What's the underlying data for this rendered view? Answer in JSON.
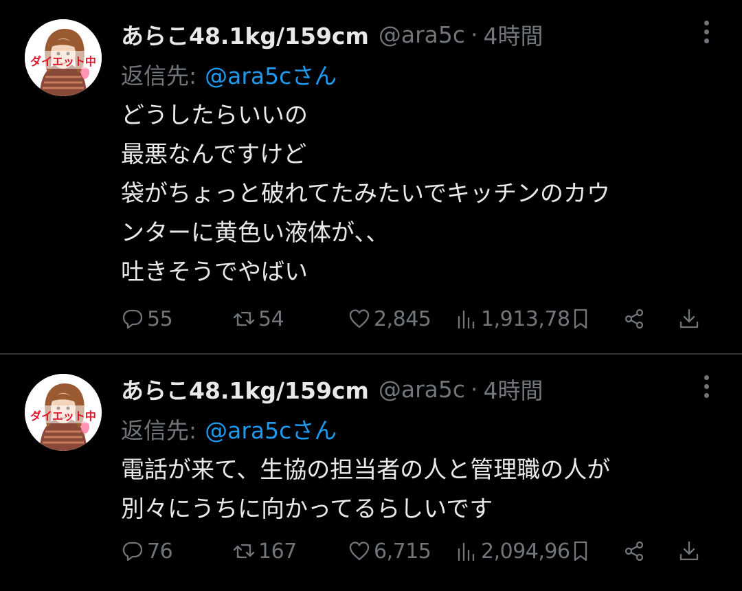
{
  "tweets": [
    {
      "author": {
        "display_name": "あらこ48.1kg/159cm",
        "handle": "@ara5c",
        "avatar_badge": "ダイエット中"
      },
      "separator": "·",
      "time": "4時間",
      "reply_label": "返信先:",
      "reply_to": "@ara5cさん",
      "lines": [
        "どうしたらいいの",
        "最悪なんですけど",
        "袋がちょっと破れてたみたいでキッチンのカウ",
        "ンターに黄色い液体が、、",
        "吐きそうでやばい"
      ],
      "stats": {
        "replies": "55",
        "retweets": "54",
        "likes": "2,845",
        "views": "1,913,78"
      }
    },
    {
      "author": {
        "display_name": "あらこ48.1kg/159cm",
        "handle": "@ara5c",
        "avatar_badge": "ダイエット中"
      },
      "separator": "·",
      "time": "4時間",
      "reply_label": "返信先:",
      "reply_to": "@ara5cさん",
      "lines": [
        "電話が来て、生協の担当者の人と管理職の人が",
        "別々にうちに向かってるらしいです"
      ],
      "stats": {
        "replies": "76",
        "retweets": "167",
        "likes": "6,715",
        "views": "2,094,96"
      }
    }
  ],
  "icons": {
    "more": "more-vertical-icon",
    "reply": "comment-bubble-icon",
    "retweet": "retweet-icon",
    "like": "heart-icon",
    "views": "bar-chart-icon",
    "bookmark": "bookmark-icon",
    "share": "share-icon",
    "download": "download-icon"
  },
  "colors": {
    "background": "#000000",
    "text": "#e7e9ea",
    "muted": "#71767b",
    "link": "#1d9bf0",
    "divider": "#2f3336"
  }
}
